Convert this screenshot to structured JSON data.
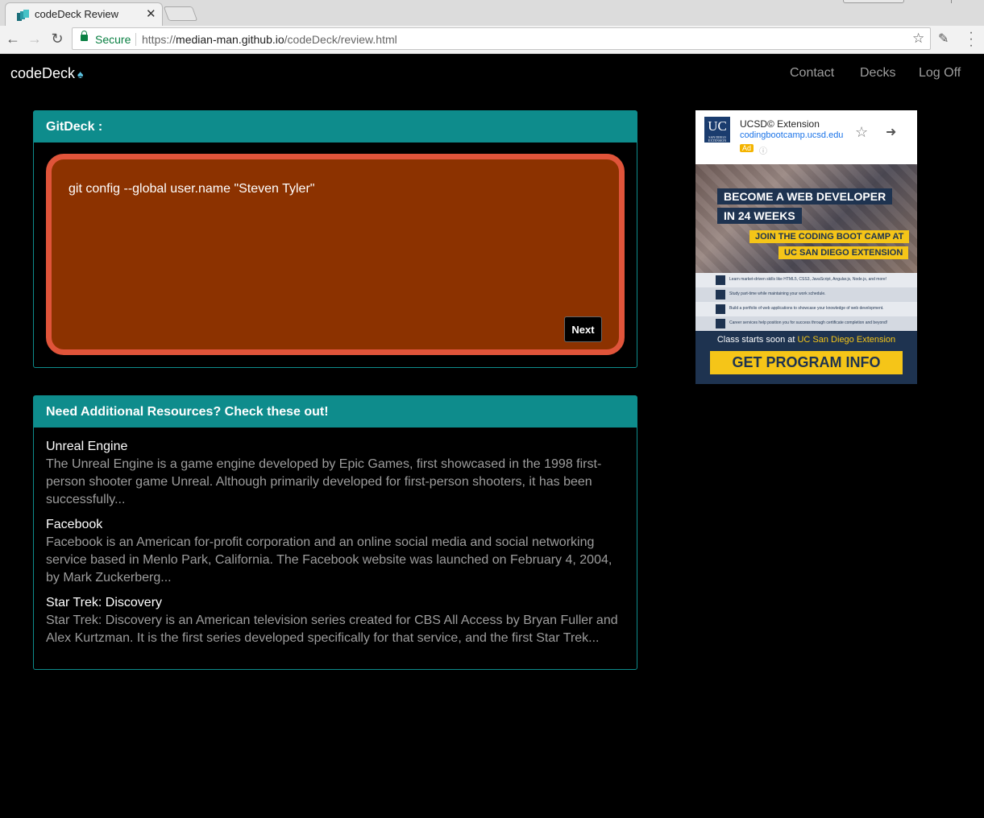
{
  "browser": {
    "tab_title": "codeDeck Review",
    "secure_label": "Secure",
    "url_scheme": "https://",
    "url_domain": "median-man.github.io",
    "url_path": "/codeDeck/review.html"
  },
  "navbar": {
    "brand": "codeDeck",
    "brand_icon": "♠",
    "links": [
      "Contact",
      "Decks",
      "Log Off"
    ]
  },
  "deck_panel": {
    "heading": "GitDeck :",
    "card_text": "git config --global user.name \"Steven Tyler\"",
    "next_label": "Next"
  },
  "resources_panel": {
    "heading": "Need Additional Resources? Check these out!",
    "items": [
      {
        "title": "Unreal Engine",
        "description": "The Unreal Engine is a game engine developed by Epic Games, first showcased in the 1998 first-person shooter game Unreal. Although primarily developed for first-person shooters, it has been successfully..."
      },
      {
        "title": "Facebook",
        "description": "Facebook is an American for-profit corporation and an online social media and social networking service based in Menlo Park, California. The Facebook website was launched on February 4, 2004, by Mark Zuckerberg..."
      },
      {
        "title": "Star Trek: Discovery",
        "description": "Star Trek: Discovery is an American television series created for CBS All Access by Bryan Fuller and Alex Kurtzman. It is the first series developed specifically for that service, and the first Star Trek..."
      }
    ]
  },
  "ad": {
    "logo": "UC",
    "logo_sub": "SAN DIEGO EXTENSION",
    "advertiser": "UCSD© Extension",
    "domain": "codingbootcamp.ucsd.edu",
    "badge": "Ad",
    "headline_1": "BECOME A WEB DEVELOPER",
    "headline_2": "IN 24 WEEKS",
    "subhead_1": "JOIN THE CODING BOOT CAMP AT",
    "subhead_2": "UC SAN DIEGO EXTENSION",
    "bullets": [
      "Learn market-driven skills like HTML5, CSS3, JavaScript, Angular.js, Node.js, and more!",
      "Study part-time while maintaining your work schedule.",
      "Build a portfolio of web applications to showcase your knowledge of web development.",
      "Career services help position you for success through certificate completion and beyond!"
    ],
    "class_prefix": "Class starts soon at ",
    "class_highlight": "UC San Diego Extension",
    "cta": "GET PROGRAM INFO"
  },
  "colors": {
    "panel_heading": "#0e8c8c",
    "card_fill": "#8c3200",
    "card_border": "#e0543a",
    "ad_navy": "#1e3350",
    "ad_yellow": "#f5c518"
  }
}
